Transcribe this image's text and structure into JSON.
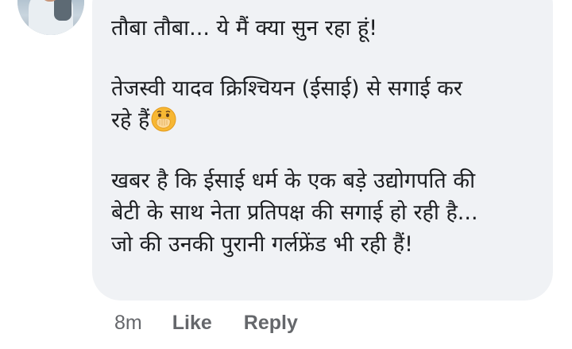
{
  "comment": {
    "paragraphs": [
      [
        "तौबा तौबा... ये मैं क्या सुन रहा हूं!"
      ],
      [
        "तेजस्वी यादव क्रिश्चियन (ईसाई) से सगाई कर",
        "रहे हैं"
      ],
      [
        "खबर है कि ईसाई धर्म के एक बड़े उद्योगपति की",
        "बेटी के साथ नेता प्रतिपक्ष की सगाई हो रही है...",
        "जो की उनकी पुरानी गर्लफ्रेंड भी रही हैं!"
      ]
    ],
    "emoji": "face-with-hand-over-mouth-icon"
  },
  "actions": {
    "time": "8m",
    "like": "Like",
    "reply": "Reply"
  },
  "colors": {
    "bubble": "#f0f2f5",
    "text": "#1c1e21",
    "meta": "#65676b",
    "emoji": "#f7b733"
  }
}
